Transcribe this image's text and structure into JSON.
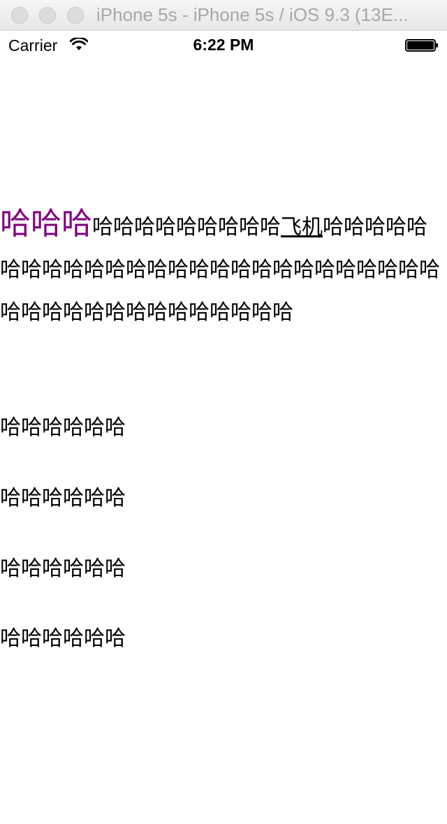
{
  "simulator": {
    "window_title": "iPhone 5s - iPhone 5s / iOS 9.3 (13E..."
  },
  "status_bar": {
    "carrier": "Carrier",
    "time": "6:22 PM",
    "wifi_icon": "wifi-icon",
    "battery_icon": "battery-icon"
  },
  "content": {
    "paragraph": {
      "lead": "哈哈哈",
      "lead_color": "#800080",
      "middle": "哈哈哈哈哈哈哈哈哈",
      "link": "飞机",
      "tail": "哈哈哈哈哈哈哈哈哈哈哈哈哈哈哈哈哈哈哈哈哈哈哈哈哈哈哈哈哈哈哈哈哈哈哈哈哈哈哈哈"
    },
    "lines": [
      "哈哈哈哈哈哈",
      "哈哈哈哈哈哈",
      "哈哈哈哈哈哈",
      "哈哈哈哈哈哈"
    ]
  }
}
